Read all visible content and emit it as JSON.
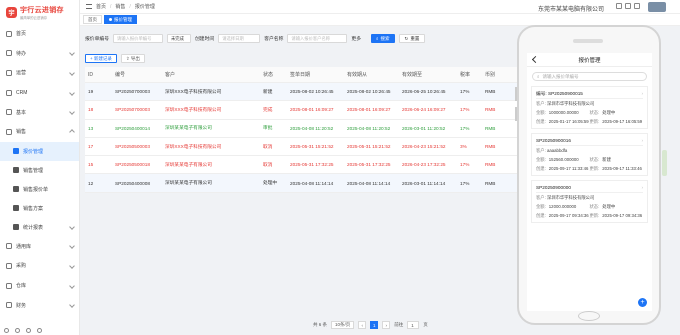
{
  "app": {
    "logo_mark": "宇",
    "logo_title": "宇行云进销存",
    "logo_subtitle": "最简单的云进销存",
    "company": "东莞市某某电脑有限公司"
  },
  "sidebar": {
    "items": [
      {
        "label": "首页"
      },
      {
        "label": "待办"
      },
      {
        "label": "运营"
      },
      {
        "label": "CRM"
      },
      {
        "label": "基本"
      },
      {
        "label": "销售"
      }
    ],
    "sub_items": [
      {
        "label": "报价管理",
        "active": true
      },
      {
        "label": "销售管理",
        "active": false
      },
      {
        "label": "销售报价单",
        "active": false
      },
      {
        "label": "销售方案",
        "active": false
      },
      {
        "label": "统计报表",
        "active": false
      }
    ],
    "items2": [
      {
        "label": "通用库"
      },
      {
        "label": "采购"
      },
      {
        "label": "仓库"
      },
      {
        "label": "财务"
      }
    ]
  },
  "breadcrumb": [
    "首页",
    "销售",
    "报价管理"
  ],
  "tabs": [
    {
      "label": "首页"
    },
    {
      "label": "报价管理"
    }
  ],
  "filters": {
    "quote_no_label": "报价单编号",
    "quote_no_placeholder": "请输入报价单编号",
    "status_value": "未完成",
    "date_label": "创建时间",
    "date_placeholder": "请选择日期",
    "customer_label": "客户名称",
    "customer_placeholder": "请输入报价客户名称",
    "more_label": "更多",
    "search_label": "搜索",
    "reset_label": "重置"
  },
  "actions": {
    "new_label": "+ 新建记录",
    "export_label": "导出"
  },
  "table": {
    "headers": [
      "ID",
      "编号",
      "客户",
      "状态",
      "签单日期",
      "有效期从",
      "有效期至",
      "税率",
      "币别"
    ],
    "rows": [
      {
        "id": "19",
        "no": "SP20250700003",
        "customer": "深圳XXX电子科技有限公司",
        "status": "新建",
        "sign": "2025-08-02 10:26:45",
        "from": "2025-08-02 10:26:45",
        "to": "2026-06-25 10:26:45",
        "tax": "17%",
        "cur": "RMB",
        "color": "#333",
        "sel": true
      },
      {
        "id": "18",
        "no": "SP20250700003",
        "customer": "深圳XXX电子科技有限公司",
        "status": "完成",
        "sign": "2025-08-01 16:09:27",
        "from": "2025-08-01 16:09:27",
        "to": "2026-06-24 16:09:27",
        "tax": "17%",
        "cur": "RMB",
        "color": "#e53935",
        "sel": false
      },
      {
        "id": "13",
        "no": "SP20250400014",
        "customer": "深圳某某电子有限公司",
        "status": "审批",
        "sign": "2025-04-08 11:20:52",
        "from": "2025-04-08 11:20:52",
        "to": "2026-03-01 11:20:52",
        "tax": "17%",
        "cur": "RMB",
        "color": "#2e9e3c",
        "sel": false
      },
      {
        "id": "17",
        "no": "SP20250500003",
        "customer": "深圳XXX电子科技有限公司",
        "status": "取消",
        "sign": "2025-05-31 15:21:52",
        "from": "2025-05-31 15:21:52",
        "to": "2026-04-23 15:21:52",
        "tax": "3%",
        "cur": "RMB",
        "color": "#e53935",
        "sel": false
      },
      {
        "id": "15",
        "no": "SP20250500018",
        "customer": "深圳某某电子有限公司",
        "status": "取消",
        "sign": "2025-05-31 17:32:25",
        "from": "2025-05-31 17:32:25",
        "to": "2026-04-23 17:32:25",
        "tax": "17%",
        "cur": "RMB",
        "color": "#e53935",
        "sel": false
      },
      {
        "id": "12",
        "no": "SP20250400008",
        "customer": "深圳某某电子有限公司",
        "status": "处理中",
        "sign": "2025-04-08 11:14:14",
        "from": "2025-04-08 11:14:14",
        "to": "2026-03-01 11:14:14",
        "tax": "17%",
        "cur": "RMB",
        "color": "#333",
        "sel": true
      }
    ]
  },
  "pager": {
    "total": "共 6 条",
    "page_size": "10条/页",
    "current": "1",
    "goto_label": "前往",
    "goto_value": "1",
    "page_suffix": "页"
  },
  "phone": {
    "title": "报价管理",
    "search_placeholder": "请输入报价单编号",
    "cards": [
      {
        "no": "编号: SP20250900015",
        "row1_label": "客户:",
        "row1_value": "深圳市华宇科技有限公司",
        "row2a_label": "金额:",
        "row2a_value": "1000000.00000",
        "row2b_label": "状态:",
        "row2b_value": "处理中",
        "row3a_label": "创建:",
        "row3a_value": "2025-01-17 16:05:59",
        "row3b_label": "更新:",
        "row3b_value": "2025-09-17 16:05:59"
      },
      {
        "no": "SP20250900016",
        "row1_label": "客户:",
        "row1_value": "aaaabbdfa",
        "row2a_label": "金额:",
        "row2a_value": "152560.000000",
        "row2b_label": "状态:",
        "row2b_value": "新建",
        "row3a_label": "创建:",
        "row3a_value": "2025-09-17 11:33:46",
        "row3b_label": "更新:",
        "row3b_value": "2025-09-17 11:33:46"
      },
      {
        "no": "SP20250900000",
        "row1_label": "客户:",
        "row1_value": "深圳市华宇科技有限公司",
        "row2a_label": "金额:",
        "row2a_value": "12000.000000",
        "row2b_label": "状态:",
        "row2b_value": "处理中",
        "row3a_label": "创建:",
        "row3a_value": "2025-09-17 09:34:36",
        "row3b_label": "更新:",
        "row3b_value": "2025-09-17 09:34:36"
      }
    ]
  }
}
